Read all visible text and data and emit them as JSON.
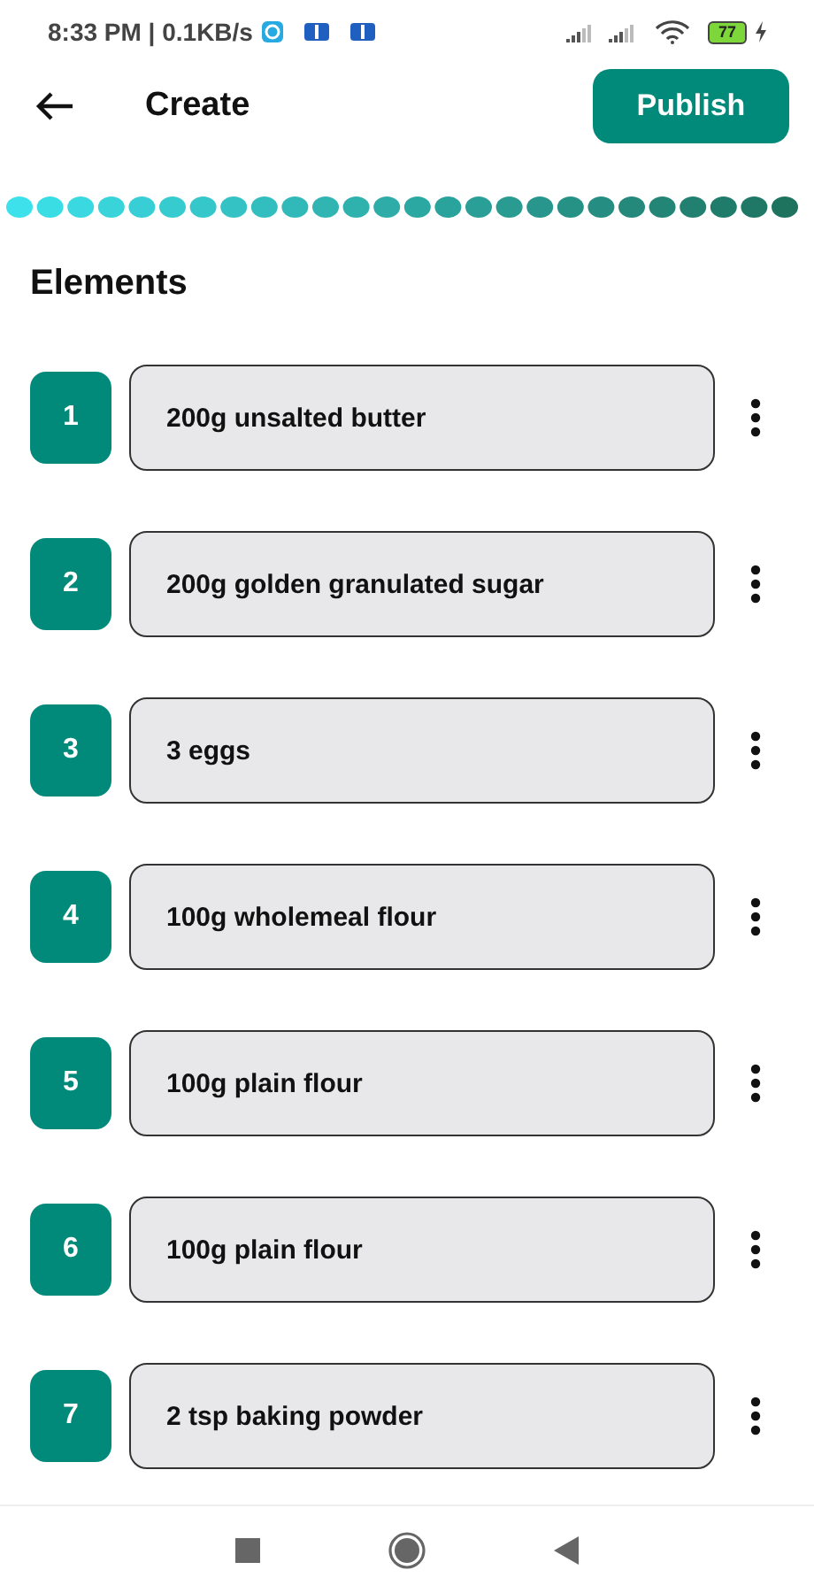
{
  "status_bar": {
    "time": "8:33 PM | 0.1KB/s",
    "battery": "77"
  },
  "header": {
    "title": "Create",
    "publish": "Publish"
  },
  "section_title": "Elements",
  "elements": [
    {
      "number": "1",
      "text": "200g unsalted butter"
    },
    {
      "number": "2",
      "text": "200g golden granulated sugar"
    },
    {
      "number": "3",
      "text": "3 eggs"
    },
    {
      "number": "4",
      "text": "100g wholemeal flour"
    },
    {
      "number": "5",
      "text": "100g plain flour"
    },
    {
      "number": "6",
      "text": "100g plain flour"
    },
    {
      "number": "7",
      "text": "2 tsp baking powder"
    }
  ]
}
